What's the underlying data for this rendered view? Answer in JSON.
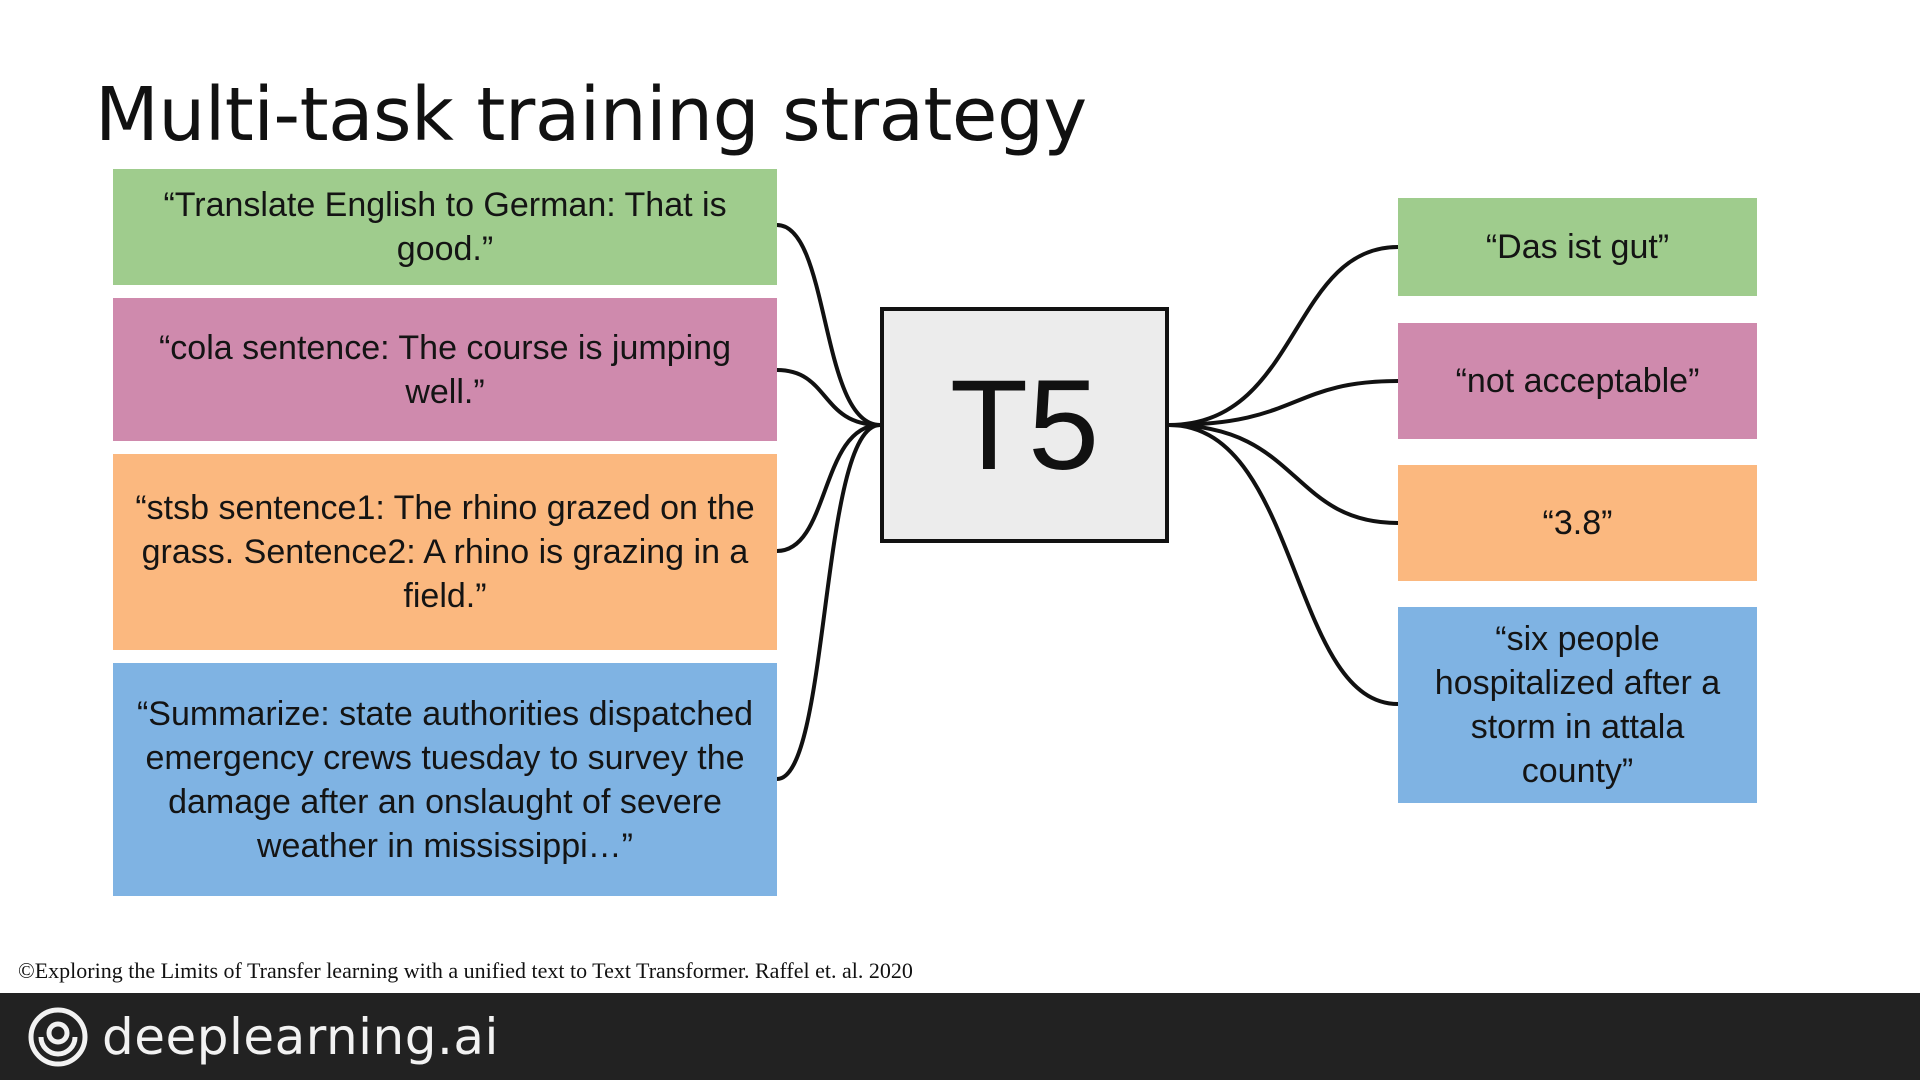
{
  "title": "Multi-task training strategy",
  "model_label": "T5",
  "inputs": [
    {
      "text": "“Translate English to German: That is good.”",
      "color": "#9fcc8d"
    },
    {
      "text": "“cola sentence:  The course is jumping well.”",
      "color": "#cf8aad"
    },
    {
      "text": "“stsb sentence1: The rhino grazed on the grass. Sentence2: A rhino is grazing in a field.”",
      "color": "#fbb87f"
    },
    {
      "text": "“Summarize: state authorities dispatched emergency crews tuesday to survey the damage after an onslaught of severe weather in mississippi…”",
      "color": "#7fb3e3"
    }
  ],
  "outputs": [
    {
      "text": "“Das ist gut”",
      "color": "#9fcc8d"
    },
    {
      "text": "“not acceptable”",
      "color": "#cf8aad"
    },
    {
      "text": "“3.8”",
      "color": "#fbb87f"
    },
    {
      "text": "“six people hospitalized after a storm in attala county”",
      "color": "#7fb3e3"
    }
  ],
  "citation": "©Exploring the Limits of Transfer learning with a unified text to Text Transformer. Raffel et. al. 2020",
  "footer": {
    "brand": "deeplearning.ai",
    "logo_icon": "deeplearning-logo-icon"
  }
}
